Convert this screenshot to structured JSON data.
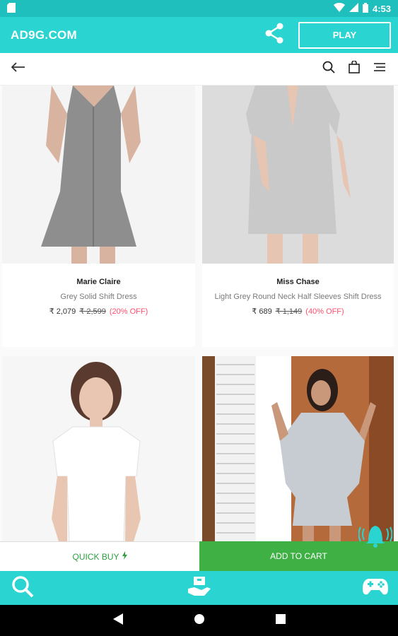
{
  "status_bar": {
    "time": "4:53",
    "icons": [
      "sd-card-icon",
      "wifi-icon",
      "signal-icon",
      "battery-icon"
    ]
  },
  "app_bar": {
    "title": "AD9G.COM",
    "play_label": "PLAY",
    "share_icon": "share-icon"
  },
  "sub_bar": {
    "icons": [
      "back-arrow-icon",
      "search-icon",
      "bag-icon",
      "menu-icon"
    ]
  },
  "products": [
    {
      "brand": "Marie Claire",
      "name": "Grey Solid Shift Dress",
      "price": "₹ 2,079",
      "mrp": "₹ 2,599",
      "discount": "(20% OFF)"
    },
    {
      "brand": "Miss Chase",
      "name": "Light Grey Round Neck Half Sleeves Shift Dress",
      "price": "₹ 689",
      "mrp": "₹ 1,149",
      "discount": "(40% OFF)"
    },
    {
      "brand": "",
      "name": "",
      "price": "",
      "mrp": "",
      "discount": ""
    },
    {
      "brand": "",
      "name": "",
      "price": "",
      "mrp": "",
      "discount": ""
    }
  ],
  "actions": {
    "quick_buy": "QUICK BUY",
    "add_to_cart": "ADD TO CART"
  },
  "bottom_nav": {
    "icons": [
      "search-icon",
      "deals-icon",
      "gamepad-icon"
    ]
  },
  "colors": {
    "accent": "#2ad4d1",
    "status": "#1fbfbd",
    "cart_green": "#3fb044",
    "discount_red": "#ff4f6e"
  }
}
